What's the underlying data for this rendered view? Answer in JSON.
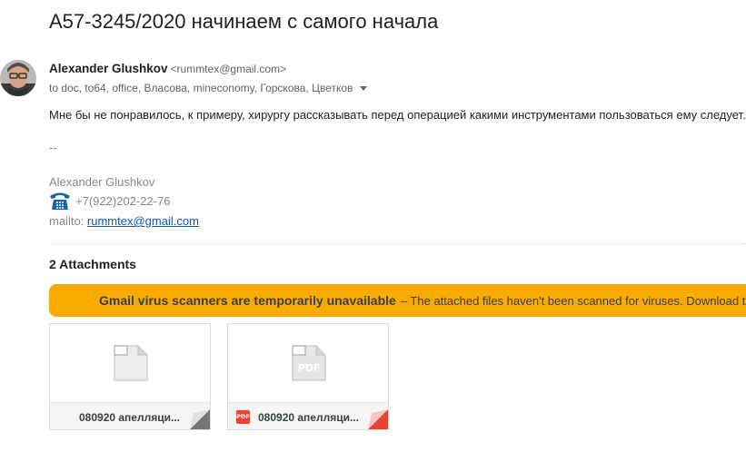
{
  "message": {
    "subject": "А57-3245/2020 начинаем с самого начала",
    "sender": {
      "name": "Alexander Glushkov",
      "email": "<rummtex@gmail.com>",
      "avatar_icon": "avatar-photo"
    },
    "recipients": "to doc, to64, office, Власова, mineconomy, Горскова, Цветков",
    "body": "Мне бы не понравилось, к примеру, хирургу рассказывать перед операцией какими инструментами пользоваться ему следует.",
    "signature": {
      "separator": "--",
      "name": "Alexander Glushkov",
      "phone_icon": "telephone-icon",
      "phone": "+7(922)202-22-76",
      "mail_prefix": "mailto: ",
      "mail_link": "rummtex@gmail.com"
    }
  },
  "attachments": {
    "header": "2 Attachments",
    "warning": {
      "title": "Gmail virus scanners are temporarily unavailable",
      "text": "– The attached files haven't been scanned for viruses. Download t",
      "color": "#f9ab00"
    },
    "items": [
      {
        "name": "080920 апелляци...",
        "icon": "generic-file-icon",
        "corner_color": "#757575"
      },
      {
        "name": "080920 апелляци...",
        "icon": "pdf-icon",
        "badge": "PDF",
        "corner_color": "#ea4335"
      }
    ]
  }
}
